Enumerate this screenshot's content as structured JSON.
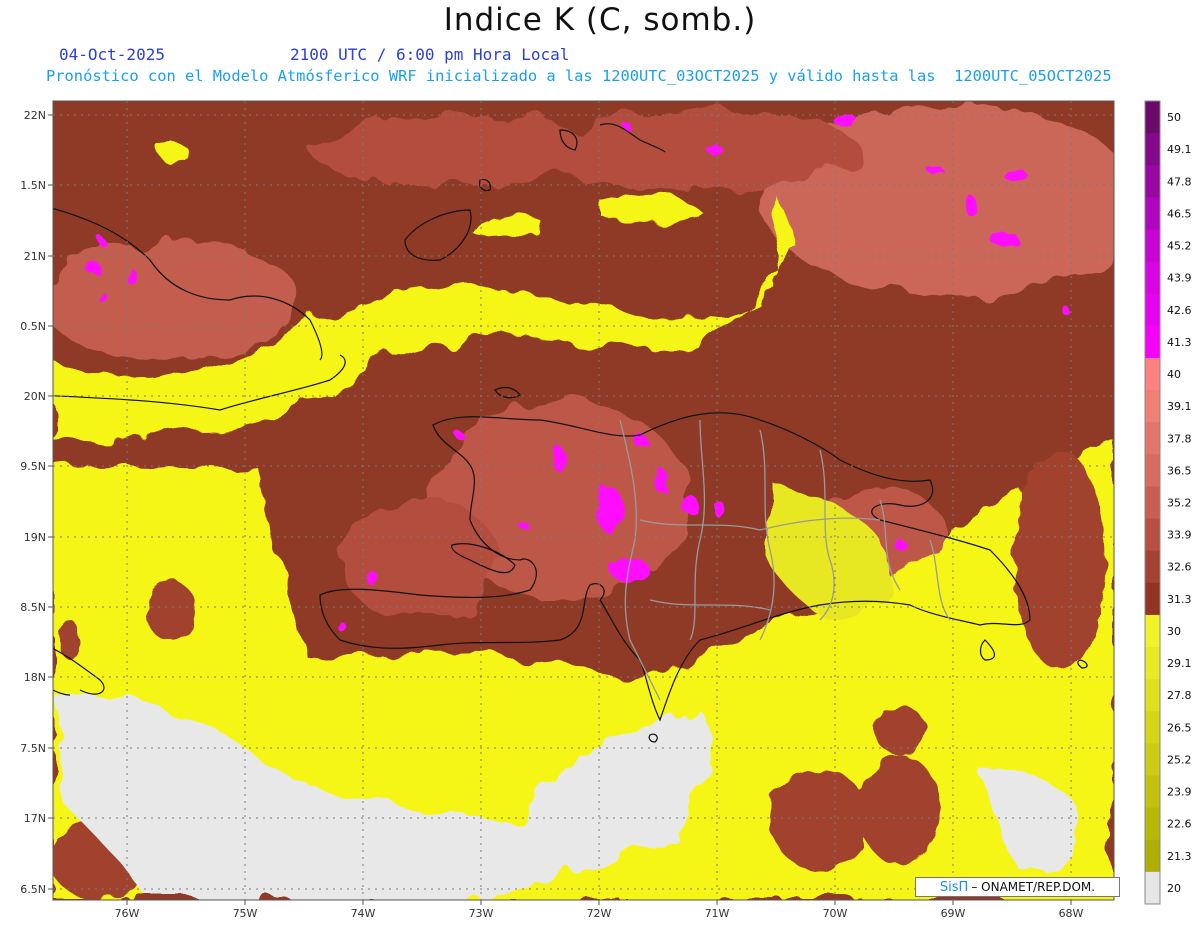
{
  "header": {
    "title": "Indice K (C, somb.)",
    "date": "04-Oct-2025",
    "time": "2100 UTC / 6:00 pm Hora Local",
    "description": "Pronóstico con el Modelo Atmósferico WRF inicializado a las 1200UTC_03OCT2025 y válido hasta las  1200UTC_05OCT2025"
  },
  "map": {
    "region": "Hispaniola and surrounding Caribbean",
    "lon_labels": [
      "76W",
      "75W",
      "74W",
      "73W",
      "72W",
      "71W",
      "70W",
      "69W",
      "68W"
    ],
    "lat_labels": [
      "22N",
      "1.5N",
      "21N",
      "0.5N",
      "20N",
      "9.5N",
      "19N",
      "8.5N",
      "18N",
      "7.5N",
      "17N",
      "6.5N"
    ],
    "colors": {
      "missing": "#e8e8e8",
      "yellow_range": "#f6f617",
      "brown_range": "#b5503f",
      "magenta_range": "#ff10ff"
    }
  },
  "colorbar": {
    "labels": [
      "50",
      "49.1",
      "47.8",
      "46.5",
      "45.2",
      "43.9",
      "42.6",
      "41.3",
      "40",
      "39.1",
      "37.8",
      "36.5",
      "35.2",
      "33.9",
      "32.6",
      "31.3",
      "30",
      "29.1",
      "27.8",
      "26.5",
      "25.2",
      "23.9",
      "22.6",
      "21.3",
      "20"
    ],
    "colors": [
      "#6b0a6b",
      "#84098a",
      "#9a08a4",
      "#b006bd",
      "#c605d4",
      "#d804e6",
      "#e802f2",
      "#f700fb",
      "#ff8080",
      "#f08074",
      "#e3766a",
      "#d66d60",
      "#c85f52",
      "#b75042",
      "#a44234",
      "#913424",
      "#f2f22a",
      "#eaea24",
      "#e0e01e",
      "#d6d618",
      "#cccc14",
      "#c2c20e",
      "#b8b808",
      "#aeae04",
      "#e6e6e6"
    ]
  },
  "credit": {
    "brand": "SisΠ",
    "text": "– ONAMET/REP.DOM."
  }
}
